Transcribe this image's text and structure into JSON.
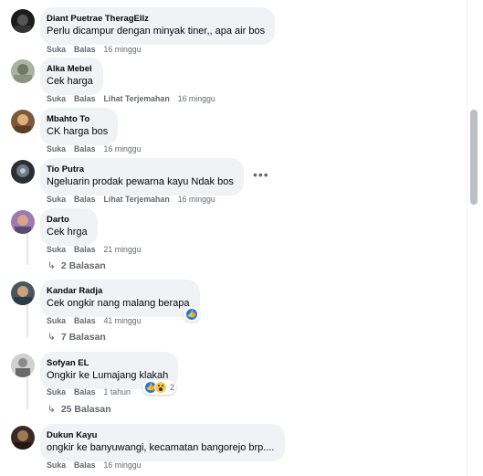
{
  "actions": {
    "like": "Suka",
    "reply": "Balas",
    "translate": "Lihat Terjemahan"
  },
  "comments": [
    {
      "author": "Diant Puetrae TheragEllz",
      "text": "Perlu dicampur dengan minyak tiner,, apa air bos",
      "time": "16 minggu"
    },
    {
      "author": "Alka Mebel",
      "text": "Cek harga",
      "time": "16 minggu"
    },
    {
      "author": "Mbahto To",
      "text": "CK harga bos",
      "time": "16 minggu"
    },
    {
      "author": "Tio Putra",
      "text": "Ngeluarin prodak pewarna kayu Ndak bos",
      "time": "16 minggu"
    },
    {
      "author": "Darto",
      "text": "Cek hrga",
      "time": "21 minggu",
      "replies": "2 Balasan"
    },
    {
      "author": "Kandar Radja",
      "text": "Cek ongkir nang malang berapa",
      "time": "41 minggu",
      "replies": "7 Balasan"
    },
    {
      "author": "Sofyan EL",
      "text": "Ongkir ke Lumajang klakah",
      "time": "1 tahun",
      "replies": "25 Balasan",
      "reaction_count": "2"
    },
    {
      "author": "Dukun Kayu",
      "text": "ongkir ke banyuwangi, kecamatan bangorejo brp....",
      "time": "16 minggu"
    }
  ],
  "more_options": "•••"
}
